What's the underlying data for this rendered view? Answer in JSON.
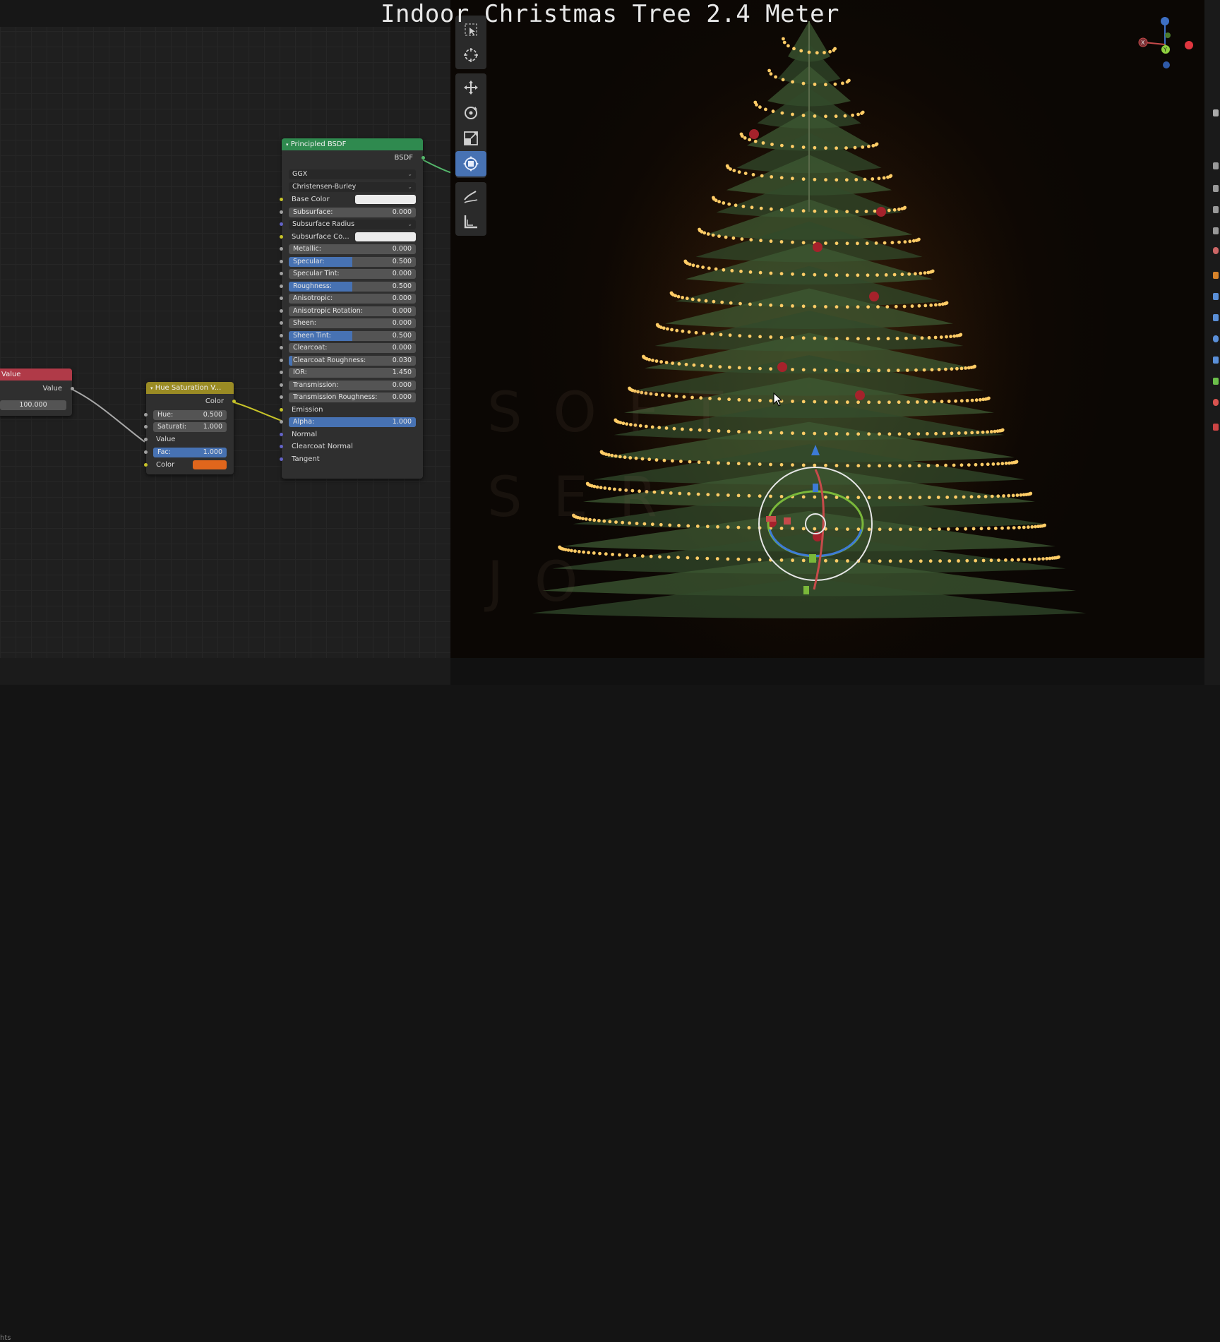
{
  "video_title": "Indoor Christmas Tree 2.4 Meter",
  "footer_text": "hts",
  "value_node": {
    "title": "Value",
    "output_label": "Value",
    "value": "100.000",
    "color": "#b03a48"
  },
  "hue_node": {
    "title": "Hue Saturation V...",
    "output_label": "Color",
    "hue_label": "Hue:",
    "hue_value": "0.500",
    "saturation_label": "Saturati:",
    "saturation_value": "1.000",
    "value_label": "Value",
    "fac_label": "Fac:",
    "fac_value": "1.000",
    "color_label": "Color",
    "color_swatch": "#e0661c",
    "header_color": "#9a8b24"
  },
  "bsdf_node": {
    "title": "Principled BSDF",
    "output_label": "BSDF",
    "distribution": "GGX",
    "subsurface_method": "Christensen-Burley",
    "header_color": "#2f8a4f",
    "rows": [
      {
        "label": "Base Color",
        "type": "color",
        "swatch": "#ececec"
      },
      {
        "label": "Subsurface:",
        "type": "value",
        "value": "0.000",
        "fill": 0
      },
      {
        "label": "Subsurface Radius",
        "type": "dropdown"
      },
      {
        "label": "Subsurface Co...",
        "type": "color",
        "swatch": "#ececec"
      },
      {
        "label": "Metallic:",
        "type": "value",
        "value": "0.000",
        "fill": 0
      },
      {
        "label": "Specular:",
        "type": "value",
        "value": "0.500",
        "fill": 0.5
      },
      {
        "label": "Specular Tint:",
        "type": "value",
        "value": "0.000",
        "fill": 0
      },
      {
        "label": "Roughness:",
        "type": "value",
        "value": "0.500",
        "fill": 0.5
      },
      {
        "label": "Anisotropic:",
        "type": "value",
        "value": "0.000",
        "fill": 0
      },
      {
        "label": "Anisotropic Rotation:",
        "type": "value",
        "value": "0.000",
        "fill": 0
      },
      {
        "label": "Sheen:",
        "type": "value",
        "value": "0.000",
        "fill": 0
      },
      {
        "label": "Sheen Tint:",
        "type": "value",
        "value": "0.500",
        "fill": 0.5
      },
      {
        "label": "Clearcoat:",
        "type": "value",
        "value": "0.000",
        "fill": 0
      },
      {
        "label": "Clearcoat Roughness:",
        "type": "value",
        "value": "0.030",
        "fill": 0.03
      },
      {
        "label": "IOR:",
        "type": "value",
        "value": "1.450",
        "fill": 0
      },
      {
        "label": "Transmission:",
        "type": "value",
        "value": "0.000",
        "fill": 0
      },
      {
        "label": "Transmission Roughness:",
        "type": "value",
        "value": "0.000",
        "fill": 0
      },
      {
        "label": "Emission",
        "type": "label"
      },
      {
        "label": "Alpha:",
        "type": "value",
        "value": "1.000",
        "fill": 1
      },
      {
        "label": "Normal",
        "type": "label"
      },
      {
        "label": "Clearcoat Normal",
        "type": "label"
      },
      {
        "label": "Tangent",
        "type": "label"
      }
    ]
  },
  "toolbar": {
    "tools": [
      {
        "name": "select-box-tool",
        "icon": "select-box-icon",
        "active": false
      },
      {
        "name": "cursor-tool",
        "icon": "cursor-crosshair-icon",
        "active": false
      },
      {
        "name": "move-tool",
        "icon": "move-arrows-icon",
        "active": false
      },
      {
        "name": "rotate-tool",
        "icon": "rotate-icon",
        "active": false
      },
      {
        "name": "scale-tool",
        "icon": "scale-icon",
        "active": false
      },
      {
        "name": "transform-tool",
        "icon": "transform-icon",
        "active": true
      },
      {
        "name": "annotate-tool",
        "icon": "annotate-pen-icon",
        "active": false
      },
      {
        "name": "measure-tool",
        "icon": "measure-ruler-icon",
        "active": false
      }
    ]
  },
  "gizmo": {
    "axes": [
      "X",
      "Y",
      "Z"
    ]
  },
  "watermark_lines": [
    "SOFT",
    "SER",
    "JO"
  ],
  "colors": {
    "accent": "#4772b3",
    "light_bulb": "#ffcc66",
    "tree_green": "#3d5a33"
  }
}
